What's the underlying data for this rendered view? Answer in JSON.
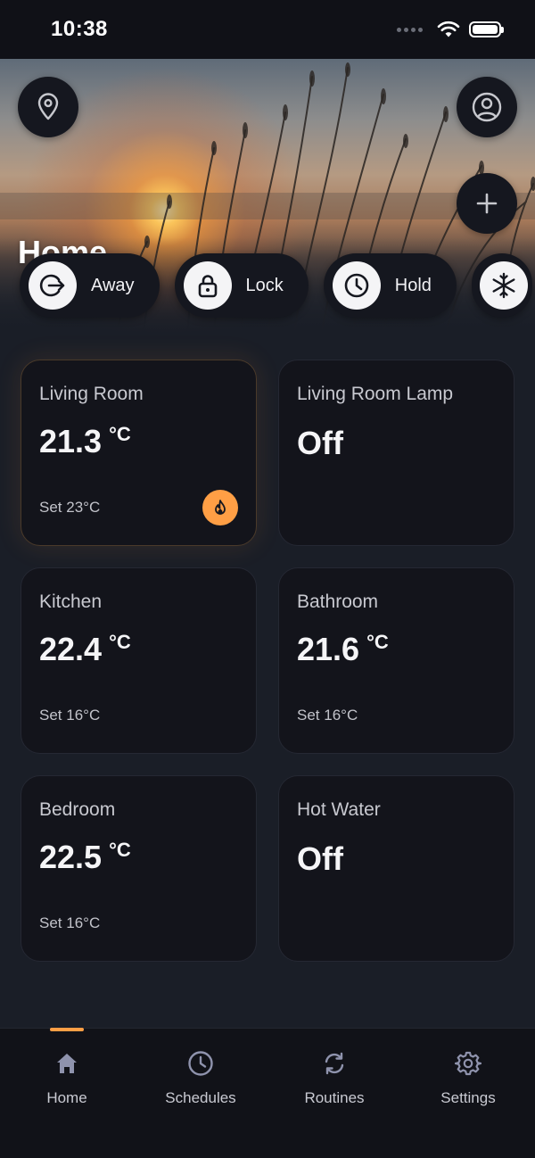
{
  "status_bar": {
    "time": "10:38"
  },
  "hero": {
    "title": "Home",
    "left_button_icon": "location-pin-icon",
    "right_button_icon": "user-profile-icon",
    "add_button_icon": "plus-icon"
  },
  "modes": [
    {
      "label": "Away",
      "icon": "away-exit-icon"
    },
    {
      "label": "Lock",
      "icon": "lock-icon"
    },
    {
      "label": "Hold",
      "icon": "clock-icon"
    },
    {
      "label": "",
      "icon": "snowflake-icon"
    }
  ],
  "devices": [
    {
      "name": "Living Room",
      "value": "21.3",
      "unit": "°C",
      "set": "Set 23°C",
      "heating": true
    },
    {
      "name": "Living Room Lamp",
      "state": "Off"
    },
    {
      "name": "Kitchen",
      "value": "22.4",
      "unit": "°C",
      "set": "Set 16°C"
    },
    {
      "name": "Bathroom",
      "value": "21.6",
      "unit": "°C",
      "set": "Set 16°C"
    },
    {
      "name": "Bedroom",
      "value": "22.5",
      "unit": "°C",
      "set": "Set 16°C"
    },
    {
      "name": "Hot Water",
      "state": "Off"
    }
  ],
  "nav": [
    {
      "label": "Home",
      "icon": "home-icon",
      "active": true
    },
    {
      "label": "Schedules",
      "icon": "clock-icon"
    },
    {
      "label": "Routines",
      "icon": "refresh-icon"
    },
    {
      "label": "Settings",
      "icon": "gear-icon"
    }
  ],
  "colors": {
    "accent": "#ff9f45",
    "background": "#1a1e27",
    "card": "#13141b"
  }
}
